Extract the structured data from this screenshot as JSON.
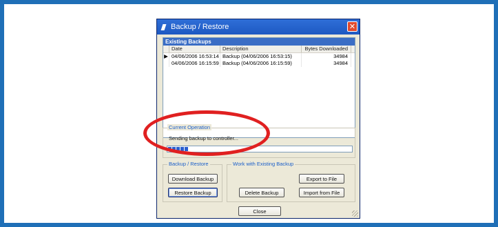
{
  "window": {
    "title": "Backup / Restore",
    "close_glyph": "✕"
  },
  "backups": {
    "caption": "Existing Backups",
    "columns": [
      "Date",
      "Description",
      "Bytes Downloaded"
    ],
    "rows": [
      {
        "indicator": "▶",
        "date": "04/06/2006 16:53:14",
        "description": "Backup (04/06/2006 16:53:15)",
        "bytes": "34984"
      },
      {
        "indicator": "",
        "date": "04/06/2006 16:15:59",
        "description": "Backup (04/06/2006 16:15:59)",
        "bytes": "34984"
      }
    ]
  },
  "current_operation": {
    "label": "Current Operation",
    "status": "Sending backup to controller...",
    "progress": 0.12
  },
  "backup_restore": {
    "label": "Backup / Restore",
    "download": "Download Backup",
    "restore": "Restore Backup"
  },
  "existing": {
    "label": "Work with Existing Backup",
    "export": "Export to File",
    "delete": "Delete Backup",
    "import": "Import from File"
  },
  "footer": {
    "close": "Close"
  },
  "colors": {
    "accent": "#3a6dc5",
    "annotation": "#e02020",
    "frame": "#1f6fb7"
  }
}
